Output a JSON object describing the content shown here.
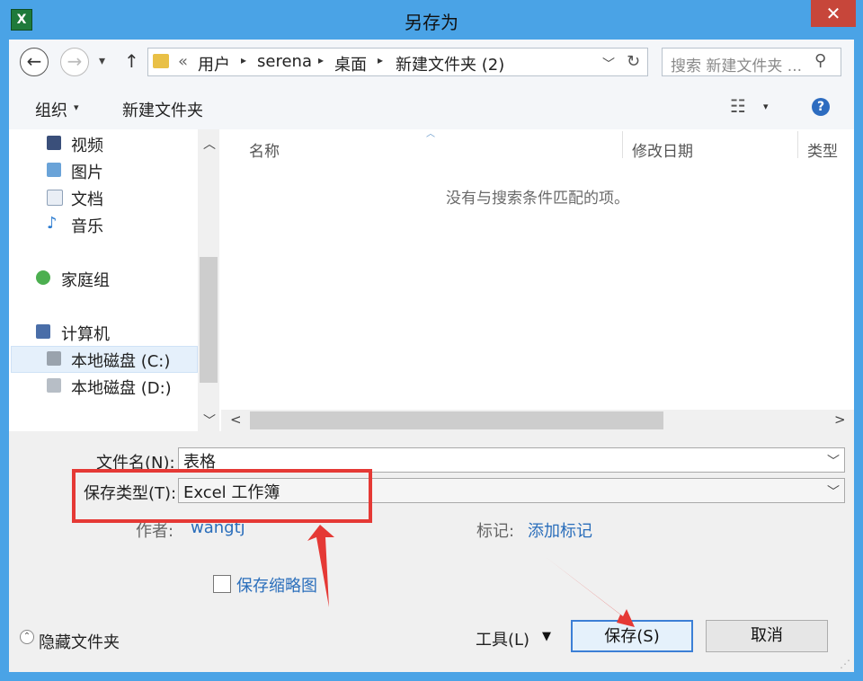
{
  "window": {
    "title": "另存为",
    "app_icon": "excel-icon",
    "close_glyph": "✕"
  },
  "nav": {
    "back_glyph": "←",
    "forward_glyph": "→",
    "recent_glyph": "▾",
    "up_glyph": "↑",
    "address_prefix": "«",
    "breadcrumbs": [
      "用户",
      "serena",
      "桌面",
      "新建文件夹 (2)"
    ],
    "crumb_separator": "▸",
    "refresh_glyph": "↻",
    "search_placeholder": "搜索 新建文件夹 ...",
    "search_glyph": "⚲"
  },
  "toolbar": {
    "organize_label": "组织",
    "organize_glyph": "▾",
    "new_folder_label": "新建文件夹",
    "view_glyph": "☷",
    "view_dropdown_glyph": "▾",
    "help_glyph": "?"
  },
  "sidebar": {
    "items": [
      {
        "label": "视频"
      },
      {
        "label": "图片"
      },
      {
        "label": "文档"
      },
      {
        "label": "音乐"
      },
      {
        "label": "家庭组"
      },
      {
        "label": "计算机"
      },
      {
        "label": "本地磁盘 (C:)"
      },
      {
        "label": "本地磁盘 (D:)"
      }
    ],
    "scroll_up_glyph": "︿",
    "scroll_down_glyph": "﹀"
  },
  "file_list": {
    "columns": [
      "名称",
      "修改日期",
      "类型"
    ],
    "sort_glyph": "︿",
    "empty_message": "没有与搜索条件匹配的项。",
    "scroll_left_glyph": "<",
    "scroll_right_glyph": ">"
  },
  "form": {
    "filename_label": "文件名(N):",
    "filename_value": "表格",
    "filetype_label": "保存类型(T):",
    "filetype_value": "Excel 工作簿",
    "dropdown_glyph": "﹀",
    "author_label": "作者:",
    "author_value": "wangtj",
    "tags_label": "标记:",
    "tags_value": "添加标记",
    "thumbnail_label": "保存缩略图"
  },
  "footer": {
    "hide_folders_label": "隐藏文件夹",
    "hide_folders_glyph": "⌃",
    "tools_label": "工具(L)",
    "tools_glyph": "▼",
    "save_label": "保存(S)",
    "cancel_label": "取消"
  },
  "colors": {
    "title_bar": "#4aa3e6",
    "close_button": "#c7463a",
    "annotation_red": "#e53935",
    "link_blue": "#2a6ebb"
  }
}
